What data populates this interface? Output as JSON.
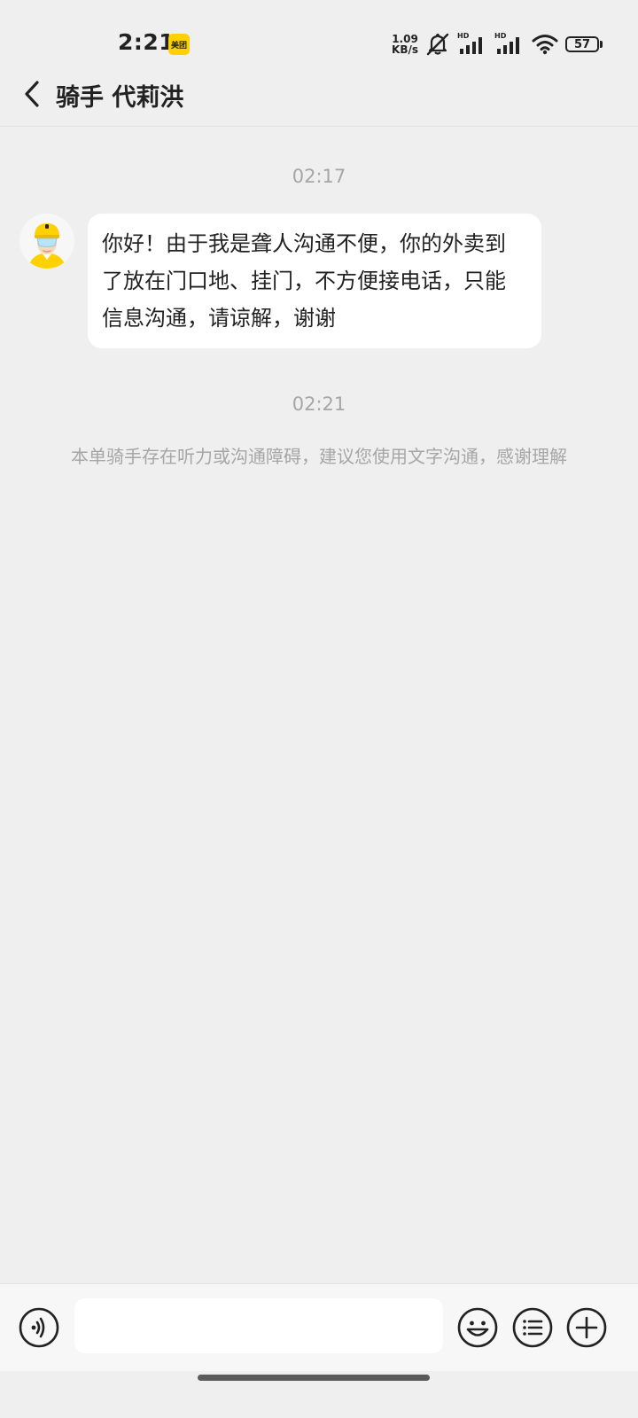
{
  "status_bar": {
    "time": "2:21",
    "app_badge": "美团",
    "net_speed_value": "1.09",
    "net_speed_unit": "KB/s",
    "sim1_label": "HD",
    "sim2_label": "HD",
    "battery": "57"
  },
  "header": {
    "title": "骑手 代莉洪"
  },
  "chat": {
    "first_time": "02:17",
    "message_text": "你好！由于我是聋人沟通不便，你的外卖到了放在门口地、挂门，不方便接电话，只能信息沟通，请谅解，谢谢",
    "second_time": "02:21",
    "system_notice": "本单骑手存在听力或沟通障碍，建议您使用文字沟通，感谢理解"
  },
  "input_bar": {
    "placeholder": "",
    "value": ""
  },
  "colors": {
    "background": "#efefef",
    "bubble": "#ffffff",
    "muted_text": "#a6a6a6",
    "brand_yellow": "#ffd100"
  },
  "icons": [
    "back-arrow-icon",
    "meituan-icon",
    "mute-icon",
    "signal-icon",
    "wifi-icon",
    "battery-icon",
    "voice-icon",
    "emoji-icon",
    "list-icon",
    "plus-icon"
  ]
}
